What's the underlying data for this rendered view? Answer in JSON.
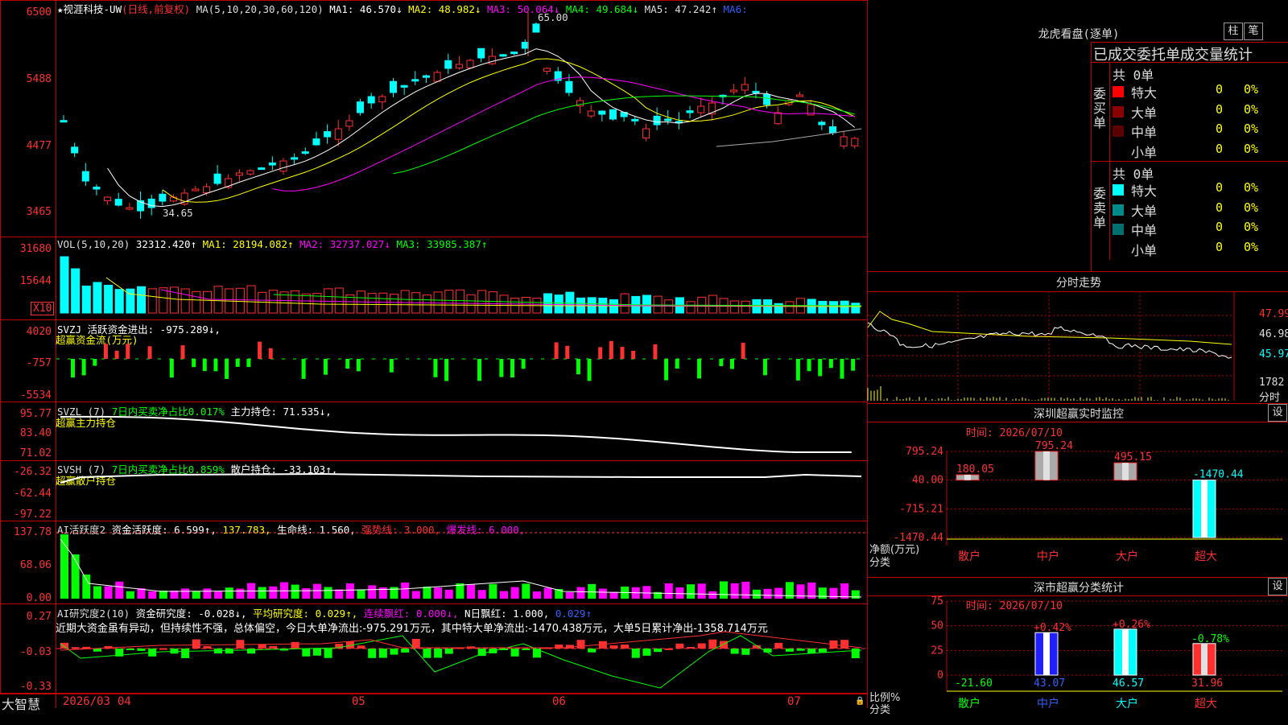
{
  "main": {
    "ticker_label": "★视涯科技-UW",
    "mode_label": "(日线,前复权)",
    "ma_label": "MA(5,10,20,30,60,120)",
    "ma1": "MA1: 46.570↓",
    "ma2": "MA2: 48.982↓",
    "ma3": "MA3: 50.064↓",
    "ma4": "MA4: 49.684↓",
    "ma5": "MA5: 47.242↑",
    "ma6": "MA6:",
    "y_ticks": [
      "6500",
      "5488",
      "4477",
      "3465"
    ],
    "high_mark": "65.00",
    "low_mark": "34.65"
  },
  "vol": {
    "label": "VOL(5,10,20)",
    "value": "32312.420↑",
    "ma1": "MA1: 28194.082↑",
    "ma2": "MA2: 32737.027↓",
    "ma3": "MA3: 33985.387↑",
    "y_ticks": [
      "31680",
      "15644"
    ],
    "unit": "X10"
  },
  "svzj": {
    "label": "SVZJ  活跃资金进出: -975.289↓,",
    "sub": "超赢资金流(万元)",
    "y_ticks": [
      "4020",
      "-757",
      "-5534"
    ]
  },
  "svzl": {
    "label": "SVZL (7)",
    "ratio": "7日内买卖净占比0.017%",
    "value": "主力持仓: 71.535↓,",
    "sub": "超赢主力持仓",
    "y_ticks": [
      "95.77",
      "83.40",
      "71.02"
    ]
  },
  "svsh": {
    "label": "SVSH (7)",
    "ratio": "7日内买卖净占比0.859%",
    "value": "散户持仓: -33.103↑,",
    "sub": "超赢散户持仓",
    "y_ticks": [
      "-26.32",
      "-62.44",
      "-97.22"
    ]
  },
  "ai1": {
    "label": "AI活跃度2",
    "v1": "资金活跃度: 6.599↑,",
    "v2": "137.783,",
    "v3": "生命线: 1.560,",
    "v4": "强势线: 3.000,",
    "v5": "爆发线: 6.000,",
    "y_ticks": [
      "137.78",
      "68.06",
      "0.00"
    ]
  },
  "ai2": {
    "label": "AI研究度2(10)",
    "v1": "资金研究度: -0.028↓,",
    "v2": "平均研究度: 0.029↑,",
    "v3": "连续飘红: 0.000↓,",
    "v4": "N日飘红: 1.000,",
    "v5": "0.029↑",
    "comment": "近期大资金虽有异动，但持续性不强，总体偏空，今日大单净流出:-975.291万元，其中特大单净流出:-1470.438万元，大单5日累计净出-1358.714万元",
    "y_ticks": [
      "0.27",
      "-0.03",
      "-0.33"
    ]
  },
  "xaxis": {
    "brand": "大智慧",
    "labels": [
      "2026/03",
      "04",
      "05",
      "06",
      "07"
    ]
  },
  "right": {
    "dragon_title": "龙虎看盘(逐单)",
    "btn_bar": "柱",
    "btn_stroke": "笔",
    "stats_title": "已成交委托单成交量统计",
    "buy_side": "委买单",
    "sell_side": "委卖单",
    "buy_total": "共 0单",
    "sell_total": "共 0单",
    "buy_rows": [
      {
        "name": "特大",
        "count": "0",
        "pct": "0%",
        "color": "#ff0000"
      },
      {
        "name": "大单",
        "count": "0",
        "pct": "0%",
        "color": "#8b0000"
      },
      {
        "name": "中单",
        "count": "0",
        "pct": "0%",
        "color": "#5a0000"
      },
      {
        "name": "小单",
        "count": "0",
        "pct": "0%",
        "color": "#000000"
      }
    ],
    "sell_rows": [
      {
        "name": "特大",
        "count": "0",
        "pct": "0%",
        "color": "#00ffff"
      },
      {
        "name": "大单",
        "count": "0",
        "pct": "0%",
        "color": "#008b8b"
      },
      {
        "name": "中单",
        "count": "0",
        "pct": "0%",
        "color": "#007070"
      },
      {
        "name": "小单",
        "count": "0",
        "pct": "0%",
        "color": "#000000"
      }
    ],
    "intraday_title": "分时走势",
    "intraday_ticks": [
      "47.99",
      "46.98",
      "45.97",
      "1782",
      "分时"
    ],
    "monitor_title": "深圳超赢实时监控",
    "monitor_set": "设",
    "monitor_time": "时间: 2026/07/10",
    "monitor_y": [
      "795.24",
      "40.00",
      "-715.21",
      "-1470.44"
    ],
    "monitor_ylabel1": "净额(万元)",
    "monitor_ylabel2": "分类",
    "class_title": "深市超赢分类统计",
    "class_set": "设",
    "class_time": "时间: 2026/07/10",
    "class_y": [
      "75",
      "50",
      "25",
      "0"
    ],
    "class_ylabel1": "比例%",
    "class_ylabel2": "分类"
  },
  "chart_data": [
    {
      "type": "bar",
      "title": "深圳超赢实时监控",
      "categories": [
        "散户",
        "中户",
        "大户",
        "超大"
      ],
      "values": [
        180.05,
        795.24,
        495.15,
        -1470.44
      ],
      "ylim": [
        -1470.44,
        795.24
      ]
    },
    {
      "type": "bar",
      "title": "深市超赢分类统计",
      "categories": [
        "散户",
        "中户",
        "大户",
        "超大"
      ],
      "values": [
        21.6,
        43.07,
        46.57,
        31.96
      ],
      "bottom_values": [
        "-21.60",
        "43.07",
        "46.57",
        "31.96"
      ],
      "changes": [
        "",
        "+0.42%",
        "+0.26%",
        "-0.78%"
      ],
      "ylim": [
        0,
        75
      ]
    }
  ]
}
